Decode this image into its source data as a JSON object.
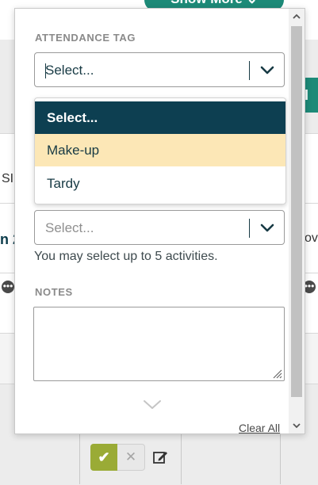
{
  "background": {
    "show_more_label": "Show More",
    "left_text_fragment_1": "SI",
    "left_text_fragment_2": "n 2",
    "right_text_fragment": "ov",
    "teal_right_fragment": "I F"
  },
  "panel": {
    "attendance_tag": {
      "label": "ATTENDANCE TAG",
      "value": "Select...",
      "options": [
        "Select...",
        "Make-up",
        "Tardy"
      ],
      "highlighted_option": "Make-up"
    },
    "activities": {
      "placeholder": "Select...",
      "helper_text": "You may select up to 5 activities."
    },
    "notes": {
      "label": "NOTES",
      "value": ""
    },
    "clear_all_label": "Clear All"
  },
  "colors": {
    "selected_option_bg": "#0d3f51",
    "highlight_option_bg": "#fce7b6",
    "accept_button": "#9aab36",
    "teal": "#1d8a78"
  },
  "icons": {
    "dropdown": "chevron-down-icon",
    "accept": "check-icon",
    "reject": "close-icon",
    "edit": "edit-note-icon",
    "more_actions": "ellipsis-icon"
  }
}
